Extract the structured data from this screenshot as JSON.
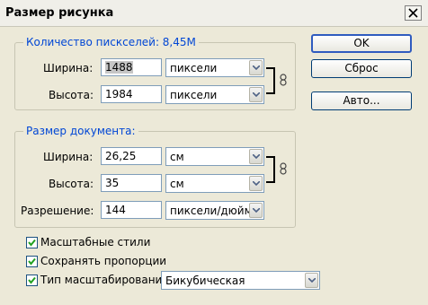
{
  "window": {
    "title": "Размер рисунка"
  },
  "pixel_group": {
    "legend": "Количество пискселей: 8,45М",
    "width_label": "Ширина:",
    "width_value": "1488",
    "width_unit": "пиксели",
    "height_label": "Высота:",
    "height_value": "1984",
    "height_unit": "пиксели"
  },
  "doc_group": {
    "legend": "Размер документа:",
    "width_label": "Ширина:",
    "width_value": "26,25",
    "width_unit": "см",
    "height_label": "Высота:",
    "height_value": "35",
    "height_unit": "см",
    "res_label": "Разрешение:",
    "res_value": "144",
    "res_unit": "пиксели/дюйм"
  },
  "options": {
    "scale_styles": {
      "label": "Масштабные стили",
      "checked": true
    },
    "constrain": {
      "label": "Сохранять пропорции",
      "checked": true
    },
    "resample": {
      "label": "Тип масштабирования:",
      "checked": true,
      "method": "Бикубическая"
    }
  },
  "buttons": {
    "ok": "OK",
    "reset": "Сброс",
    "auto": "Авто..."
  }
}
